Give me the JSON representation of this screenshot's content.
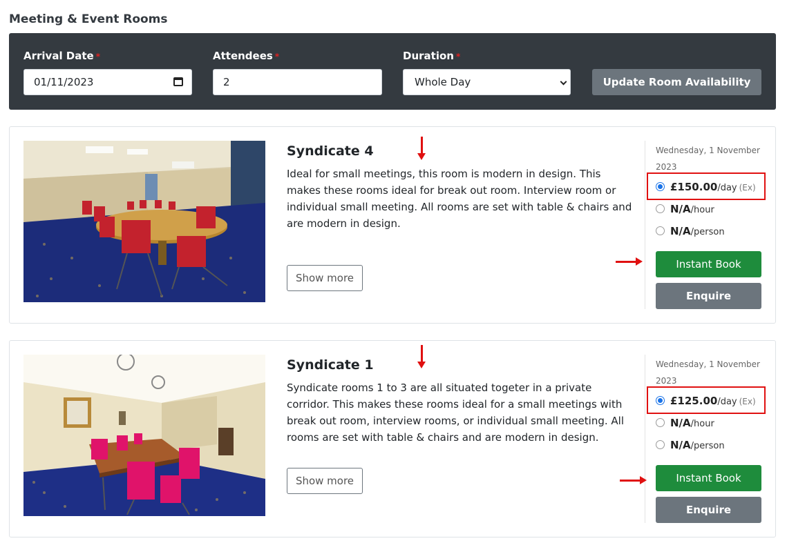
{
  "page": {
    "title": "Meeting & Event Rooms"
  },
  "search": {
    "arrival_label": "Arrival Date",
    "arrival_value": "01/11/2023",
    "attendees_label": "Attendees",
    "attendees_value": "2",
    "duration_label": "Duration",
    "duration_value": "Whole Day",
    "required_mark": "*",
    "update_label": "Update Room Availability"
  },
  "rooms": [
    {
      "name": "Syndicate 4",
      "description": "Ideal for small meetings, this room is modern in design. This makes these rooms ideal for break out room. Interview room or individual small meeting. All rooms are set with table & chairs and are modern in design.",
      "show_more": "Show more",
      "date": "Wednesday, 1 November 2023",
      "price_day": "£150.00",
      "unit_day": "/day",
      "ex": "(Ex)",
      "price_hour": "N/A",
      "unit_hour": "/hour",
      "price_person": "N/A",
      "unit_person": "/person",
      "instant_book": "Instant Book",
      "enquire": "Enquire"
    },
    {
      "name": "Syndicate 1",
      "description": "Syndicate rooms 1 to 3 are all situated togeter in a private corridor. This makes these rooms ideal for a small meetings with break out room, interview rooms, or individual small meeting. All rooms are set with table & chairs and are modern in design.",
      "show_more": "Show more",
      "date": "Wednesday, 1 November 2023",
      "price_day": "£125.00",
      "unit_day": "/day",
      "ex": "(Ex)",
      "price_hour": "N/A",
      "unit_hour": "/hour",
      "price_person": "N/A",
      "unit_person": "/person",
      "instant_book": "Instant Book",
      "enquire": "Enquire"
    }
  ],
  "colors": {
    "header_bg": "#343a40",
    "instant_book": "#1e8c3c",
    "enquire": "#6c757d",
    "annotation": "#e01010"
  },
  "icons": [
    "calendar-icon",
    "chevron-down-icon",
    "annotation-arrow"
  ]
}
